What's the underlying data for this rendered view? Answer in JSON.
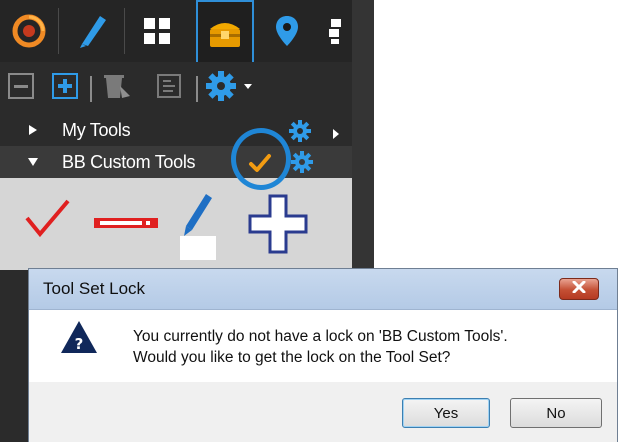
{
  "tabs": [
    {
      "icon": "bluebeam-logo-icon",
      "active": false
    },
    {
      "icon": "pen-markup-icon",
      "active": false
    },
    {
      "icon": "thumbnails-grid-icon",
      "active": false
    },
    {
      "icon": "tool-chest-icon",
      "active": true
    },
    {
      "icon": "location-pin-icon",
      "active": false
    },
    {
      "icon": "layers-icon",
      "active": false
    }
  ],
  "toolbar": {
    "icons": [
      "collapse-all-icon",
      "expand-all-icon",
      "recycle-bin-icon",
      "properties-icon",
      "gear-dropdown-icon"
    ]
  },
  "sections": {
    "my_tools": {
      "label": "My Tools"
    },
    "bb_custom_tools": {
      "label": "BB Custom Tools"
    }
  },
  "tools": [
    "checkmark-tool-icon",
    "dimension-line-tool-icon",
    "highlighter-tool-icon",
    "crosshair-tool-icon"
  ],
  "dialog": {
    "title": "Tool Set Lock",
    "message_line1": "You currently do not have a lock on 'BB Custom Tools'.",
    "message_line2": "Would you like to get the lock on the Tool Set?",
    "yes_label": "Yes",
    "no_label": "No"
  },
  "colors": {
    "accent_blue": "#1f86d6",
    "check_orange": "#f39c12",
    "tool_red": "#e02020"
  }
}
